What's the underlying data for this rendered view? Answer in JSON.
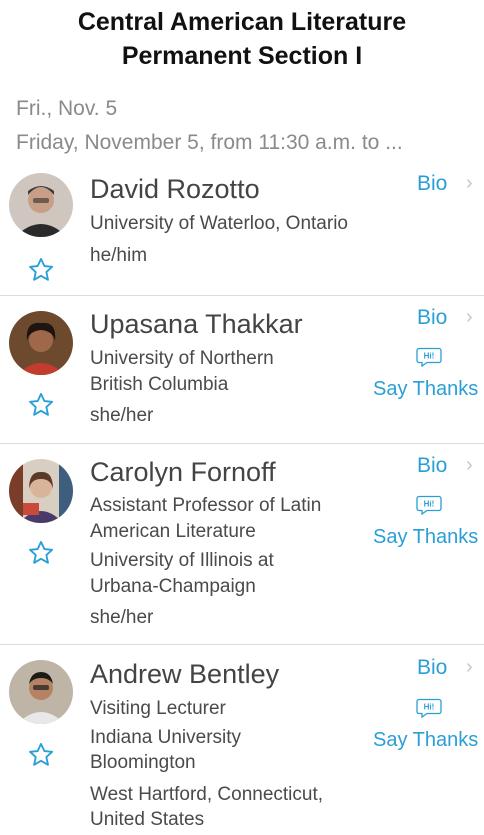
{
  "session": {
    "title_line1": "Central American Literature",
    "title_line2": "Permanent Section I",
    "date": "Fri., Nov. 5",
    "time": "Friday, November 5, from 11:30 a.m. to ..."
  },
  "speakers": [
    {
      "name": "David Rozotto",
      "lines": [
        "University of Waterloo, Ontario",
        "he/him"
      ],
      "bio_label": "Bio",
      "has_thanks": false
    },
    {
      "name": "Upasana Thakkar",
      "lines": [
        "University of Northern",
        "British Columbia",
        "she/her"
      ],
      "bio_label": "Bio",
      "hi_label": "Hi!",
      "thanks_label": "Say Thanks"
    },
    {
      "name": "Carolyn Fornoff",
      "lines": [
        "Assistant Professor of Latin",
        "American Literature",
        "University of Illinois at",
        "Urbana-Champaign",
        "she/her"
      ],
      "bio_label": "Bio",
      "hi_label": "Hi!",
      "thanks_label": "Say Thanks"
    },
    {
      "name": "Andrew Bentley",
      "lines": [
        "Visiting Lecturer",
        "Indiana University",
        "Bloomington",
        "West Hartford, Connecticut,",
        "United States"
      ],
      "bio_label": "Bio",
      "hi_label": "Hi!",
      "thanks_label": "Say Thanks"
    }
  ],
  "icons": {
    "favorite": "star-outline-icon",
    "chevron": "chevron-right-icon",
    "thanks": "hi-speech-bubble-icon"
  },
  "colors": {
    "accent": "#2a9fd6",
    "divider": "#dcdcdc"
  }
}
